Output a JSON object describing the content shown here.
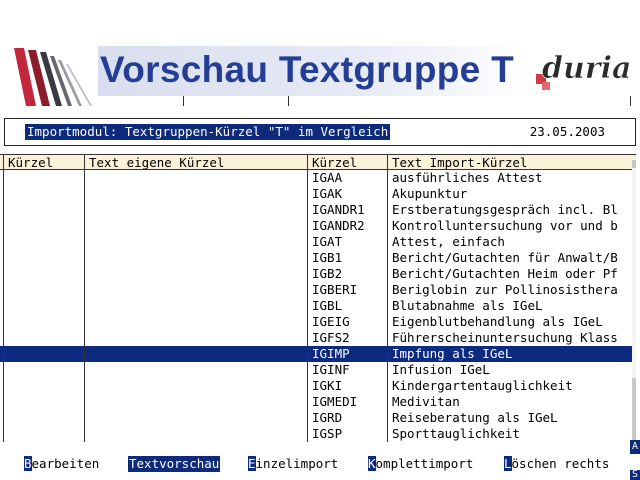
{
  "header": {
    "title": "Vorschau Textgruppe T",
    "brand": "duria"
  },
  "infoline": {
    "title": "Importmodul: Textgruppen-Kürzel \"T\" im Vergleich",
    "date": "23.05.2003"
  },
  "table": {
    "columns": [
      "Kürzel",
      "Text eigene Kürzel",
      "Kürzel",
      "Text Import-Kürzel"
    ],
    "rows": [
      {
        "own_code": "",
        "own_text": "",
        "imp_code": "IGAA",
        "imp_text": "ausführliches Attest"
      },
      {
        "own_code": "",
        "own_text": "",
        "imp_code": "IGAK",
        "imp_text": "Akupunktur"
      },
      {
        "own_code": "",
        "own_text": "",
        "imp_code": "IGANDR1",
        "imp_text": "Erstberatungsgespräch incl. Bl"
      },
      {
        "own_code": "",
        "own_text": "",
        "imp_code": "IGANDR2",
        "imp_text": "Kontrolluntersuchung vor und b"
      },
      {
        "own_code": "",
        "own_text": "",
        "imp_code": "IGAT",
        "imp_text": "Attest, einfach"
      },
      {
        "own_code": "",
        "own_text": "",
        "imp_code": "IGB1",
        "imp_text": "Bericht/Gutachten für Anwalt/B"
      },
      {
        "own_code": "",
        "own_text": "",
        "imp_code": "IGB2",
        "imp_text": "Bericht/Gutachten Heim oder Pf"
      },
      {
        "own_code": "",
        "own_text": "",
        "imp_code": "IGBERI",
        "imp_text": "Beriglobin zur Pollinosisthera"
      },
      {
        "own_code": "",
        "own_text": "",
        "imp_code": "IGBL",
        "imp_text": "Blutabnahme als IGeL"
      },
      {
        "own_code": "",
        "own_text": "",
        "imp_code": "IGEIG",
        "imp_text": "Eigenblutbehandlung als IGeL"
      },
      {
        "own_code": "",
        "own_text": "",
        "imp_code": "IGFS2",
        "imp_text": "Führerscheinuntersuchung Klass"
      },
      {
        "own_code": "",
        "own_text": "",
        "imp_code": "IGIMP",
        "imp_text": "Impfung als IGeL",
        "selected": true
      },
      {
        "own_code": "",
        "own_text": "",
        "imp_code": "IGINF",
        "imp_text": "Infusion IGeL"
      },
      {
        "own_code": "",
        "own_text": "",
        "imp_code": "IGKI",
        "imp_text": "Kindergartentauglichkeit"
      },
      {
        "own_code": "",
        "own_text": "",
        "imp_code": "IGMEDI",
        "imp_text": "Medivitan"
      },
      {
        "own_code": "",
        "own_text": "",
        "imp_code": "IGRD",
        "imp_text": "Reiseberatung als IGeL"
      },
      {
        "own_code": "",
        "own_text": "",
        "imp_code": "IGSP",
        "imp_text": "Sporttauglichkeit"
      }
    ]
  },
  "menu": [
    {
      "hotkey": "B",
      "rest": "earbeiten",
      "active": false
    },
    {
      "hotkey": "",
      "rest": "Textvorschau",
      "active": true
    },
    {
      "hotkey": "E",
      "rest": "inzelimport",
      "active": false
    },
    {
      "hotkey": "K",
      "rest": "omplettimport",
      "active": false
    },
    {
      "hotkey": "L",
      "rest": "öschen rechts",
      "active": false
    }
  ],
  "side_buttons": [
    "A",
    "S"
  ],
  "colors": {
    "title_blue": "#243e95",
    "selection": "#0b2a80",
    "header_bg": "#fbf3d9"
  }
}
